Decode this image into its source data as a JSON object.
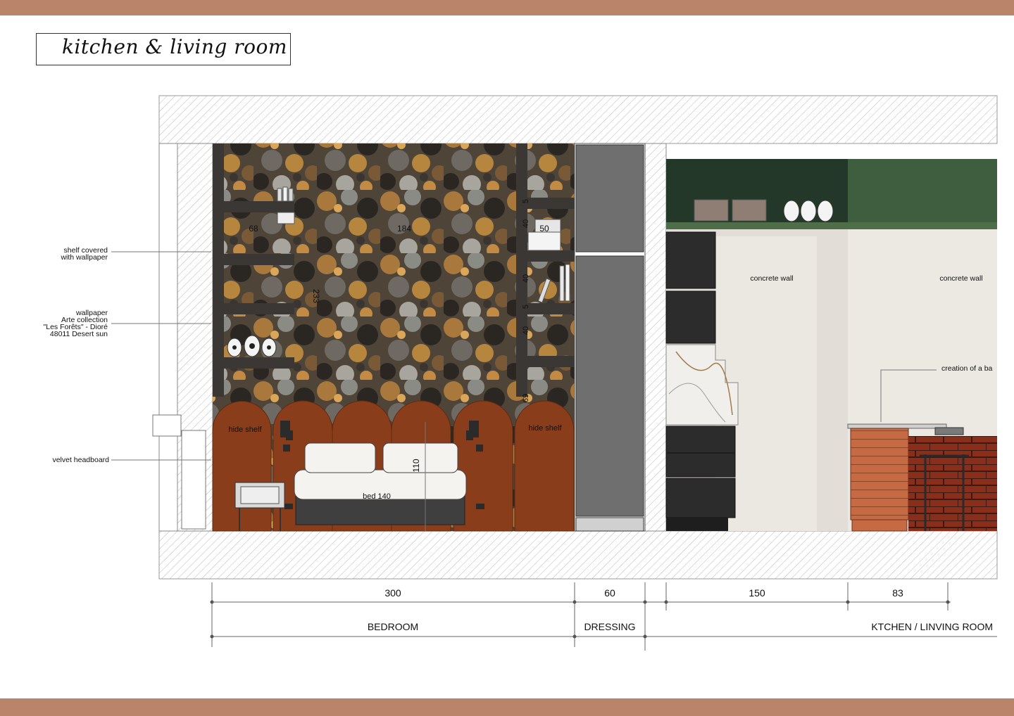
{
  "title": "kitchen & living room",
  "annotations": {
    "shelf_line1": "shelf covered",
    "shelf_line2": "with wallpaper",
    "wallpaper_line1": "wallpaper",
    "wallpaper_line2": "Arte collection",
    "wallpaper_line3": "\"Les Forêts\" - Dioré",
    "wallpaper_line4": "48011 Desert sun",
    "headboard": "velvet headboard",
    "concrete_wall_1": "concrete wall",
    "concrete_wall_2": "concrete wall",
    "bar": "creation of a ba"
  },
  "labels": {
    "hide_shelf_left": "hide shelf",
    "hide_shelf_right": "hide shelf",
    "bed": "bed 140",
    "height_110": "110"
  },
  "wall_dimensions": {
    "d68": "68",
    "d184": "184",
    "d233": "233",
    "d50": "50",
    "d40a": "40",
    "d40b": "40",
    "d40c": "40",
    "d5a": "5",
    "d5b": "5",
    "d69": "69"
  },
  "dimensions": {
    "bedroom_width": "300",
    "dressing_width": "60",
    "kitchen_width": "150",
    "bar_width": "83"
  },
  "rooms": {
    "bedroom": "BEDROOM",
    "dressing": "DRESSING",
    "kitchen": "KTCHEN / LINVING ROOM"
  },
  "colors": {
    "accent_band": "#b9846a",
    "velvet": "#8a3d1a",
    "green_cabinet": "#3f5e40",
    "concrete": "#e2ddd6",
    "dressing_gray": "#6f6f6f"
  }
}
